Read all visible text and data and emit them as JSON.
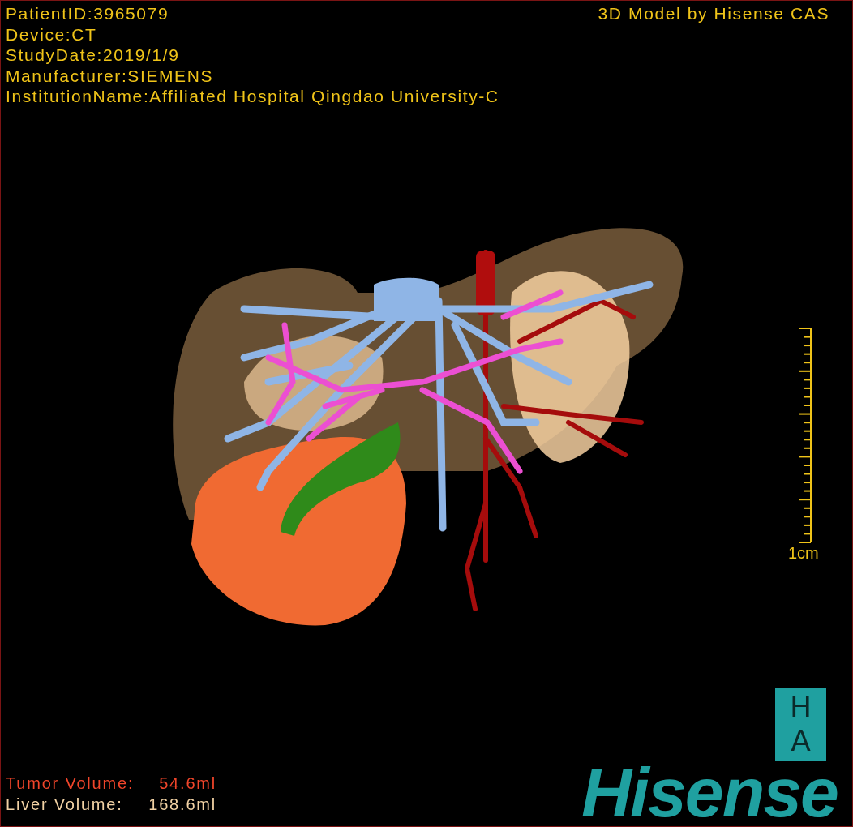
{
  "info_lines": [
    "PatientID:3965079",
    "Device:CT",
    "StudyDate:2019/1/9",
    "Manufacturer:SIEMENS",
    "InstitutionName:Affiliated Hospital Qingdao University-C"
  ],
  "title": "3D Model by Hisense CAS",
  "scale_bar": {
    "label": "1cm"
  },
  "volumes": [
    {
      "label": "Tumor Volume:",
      "value": "54.6ml",
      "color": "#f0452a"
    },
    {
      "label": "Liver Volume:",
      "value": "168.6ml",
      "color": "#f2d2a4"
    }
  ],
  "logo": {
    "badge_letters": [
      "H",
      "A"
    ],
    "brand": "Hisense"
  }
}
